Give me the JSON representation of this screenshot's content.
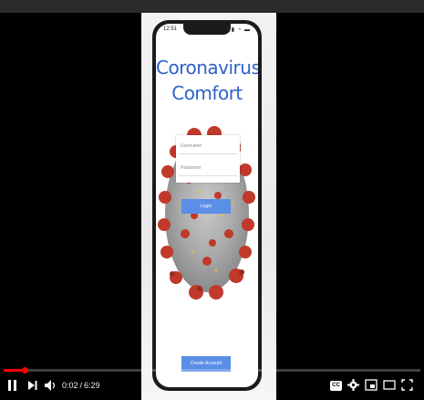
{
  "video": {
    "progress_fraction": 0.005,
    "current_time": "0:02",
    "separator": "/",
    "duration": "6:29",
    "controls": {
      "play_pause_icon": "pause-icon",
      "next_icon": "next-icon",
      "volume_icon": "volume-icon",
      "cc_label": "CC",
      "settings_icon": "gear-icon",
      "miniplayer_icon": "miniplayer-icon",
      "theater_icon": "theater-mode-icon",
      "fullscreen_icon": "fullscreen-icon"
    },
    "accent": "#ff0000"
  },
  "app": {
    "status_time": "12:51",
    "status_icons": "▮▮ ◔ ▬",
    "title_line1": "Coronavirus",
    "title_line2": "Comfort",
    "username_placeholder": "Username",
    "password_placeholder": "Password",
    "login_label": "Login",
    "create_account_label": "Create Account",
    "button_color": "#5b8ee6",
    "title_color": "#2f62c8"
  }
}
